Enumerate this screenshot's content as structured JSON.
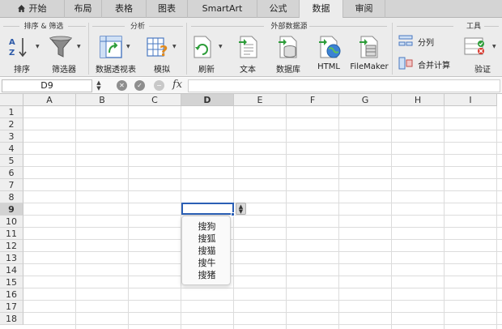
{
  "tabs": [
    {
      "label": "开始",
      "icon": "home-icon",
      "active": false
    },
    {
      "label": "布局",
      "active": false
    },
    {
      "label": "表格",
      "active": false
    },
    {
      "label": "图表",
      "active": false
    },
    {
      "label": "SmartArt",
      "active": false
    },
    {
      "label": "公式",
      "active": false
    },
    {
      "label": "数据",
      "active": true
    },
    {
      "label": "审阅",
      "active": false
    }
  ],
  "ribbon": {
    "groups": {
      "sort_filter": "排序 & 筛选",
      "analysis": "分析",
      "external": "外部数据源",
      "tools": "工具"
    },
    "buttons": {
      "sort": "排序",
      "filter": "筛选器",
      "pivot": "数据透视表",
      "whatif": "模拟",
      "refresh": "刷新",
      "text": "文本",
      "database": "数据库",
      "html": "HTML",
      "filemaker": "FileMaker",
      "split": "分列",
      "consolidate": "合并计算",
      "validate": "验证"
    }
  },
  "formula_bar": {
    "name_box": "D9",
    "fx": "fx",
    "formula": ""
  },
  "sheet": {
    "columns": [
      "A",
      "B",
      "C",
      "D",
      "E",
      "F",
      "G",
      "H",
      "I"
    ],
    "rows": [
      "1",
      "2",
      "3",
      "4",
      "5",
      "6",
      "7",
      "8",
      "9",
      "10",
      "11",
      "12",
      "13",
      "14",
      "15",
      "16",
      "17",
      "18"
    ],
    "selected_cell": "D9",
    "selected_col": "D",
    "selected_row": "9"
  },
  "dropdown": {
    "items": [
      "搜狗",
      "搜狐",
      "搜猫",
      "搜牛",
      "搜猪"
    ]
  }
}
